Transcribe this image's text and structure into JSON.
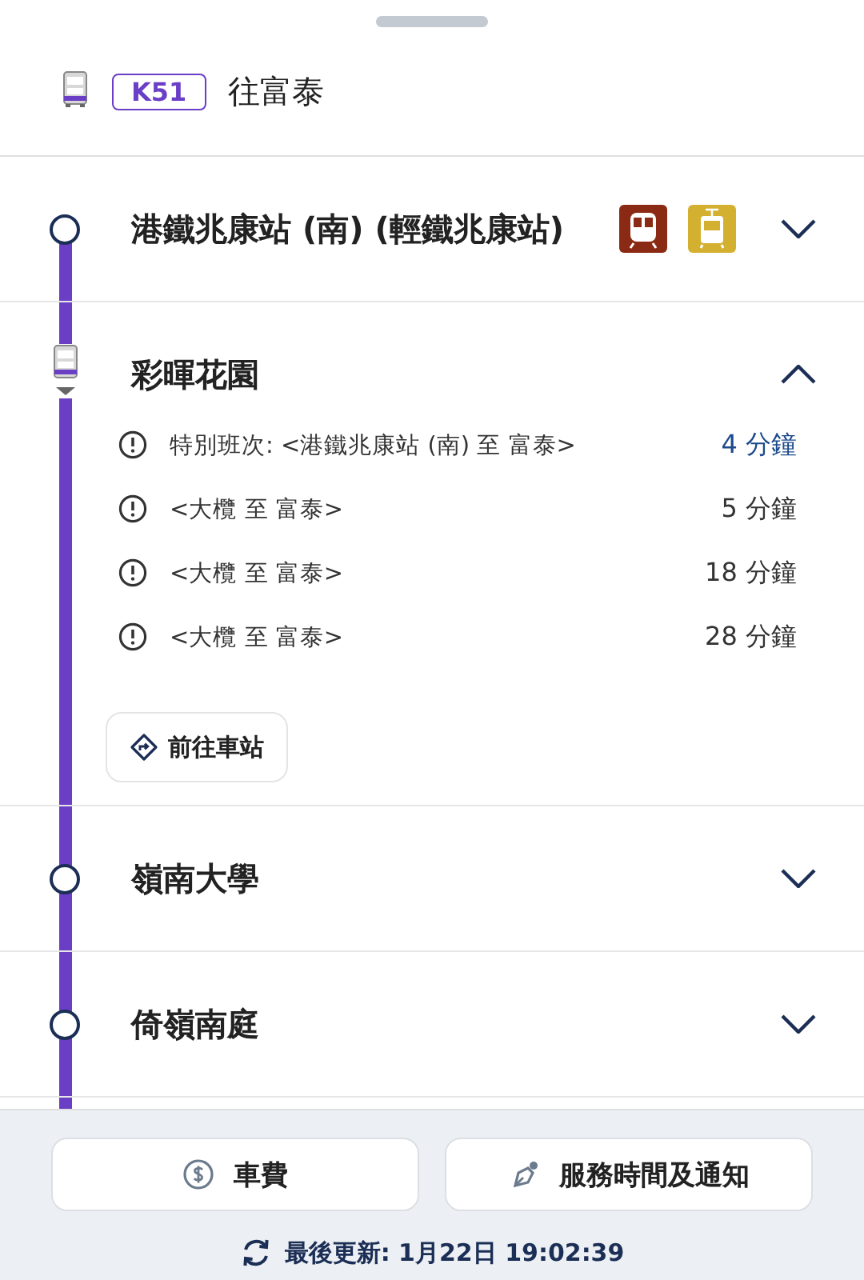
{
  "route": {
    "number": "K51",
    "destination": "往富泰"
  },
  "stops": [
    {
      "name": "港鐵兆康站 (南)  (輕鐵兆康站)",
      "kind": "stop",
      "expanded": false,
      "interchanges": [
        {
          "kind": "metro"
        },
        {
          "kind": "tram"
        }
      ]
    },
    {
      "name": "彩暉花園",
      "kind": "bus",
      "expanded": true,
      "etas": [
        {
          "remark": "特別班次: <港鐵兆康站 (南)  至 富泰>",
          "time": "4 分鐘",
          "scheduled": false
        },
        {
          "remark": "<大欖 至 富泰>",
          "time": "5 分鐘",
          "scheduled": true
        },
        {
          "remark": "<大欖 至 富泰>",
          "time": "18 分鐘",
          "scheduled": true
        },
        {
          "remark": "<大欖 至 富泰>",
          "time": "28 分鐘",
          "scheduled": true
        }
      ],
      "action": "前往車站"
    },
    {
      "name": "嶺南大學",
      "kind": "stop",
      "expanded": false
    },
    {
      "name": "倚嶺南庭",
      "kind": "stop",
      "expanded": false
    }
  ],
  "footer": {
    "buttons": [
      {
        "kind": "fare",
        "label": "車費"
      },
      {
        "kind": "notice",
        "label": "服務時間及通知"
      }
    ],
    "updated": "最後更新: 1月22日 19:02:39"
  }
}
